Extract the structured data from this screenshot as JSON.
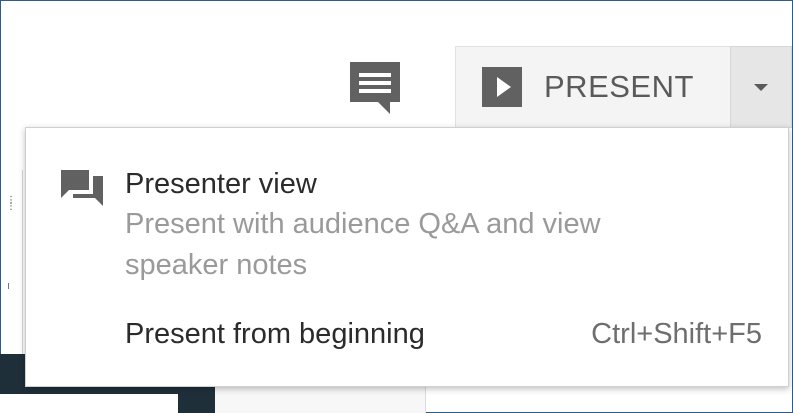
{
  "toolbar": {
    "comment_icon": "comment-icon",
    "present_icon": "play-icon",
    "present_label": "PRESENT",
    "dropdown_icon": "caret-down-icon"
  },
  "menu": {
    "presenter_view": {
      "icon": "presenter-chat-icon",
      "title": "Presenter view",
      "description": "Present with audience Q&A and view speaker notes"
    },
    "present_from_beginning": {
      "label": "Present from beginning",
      "shortcut": "Ctrl+Shift+F5"
    }
  },
  "colors": {
    "frame_border": "#2e5c8a",
    "button_bg": "#f4f4f4",
    "dropdown_bg": "#e6e6e6",
    "icon_gray": "#616161",
    "primary_text": "#2b2b2b",
    "secondary_text": "#9a9a9a"
  }
}
